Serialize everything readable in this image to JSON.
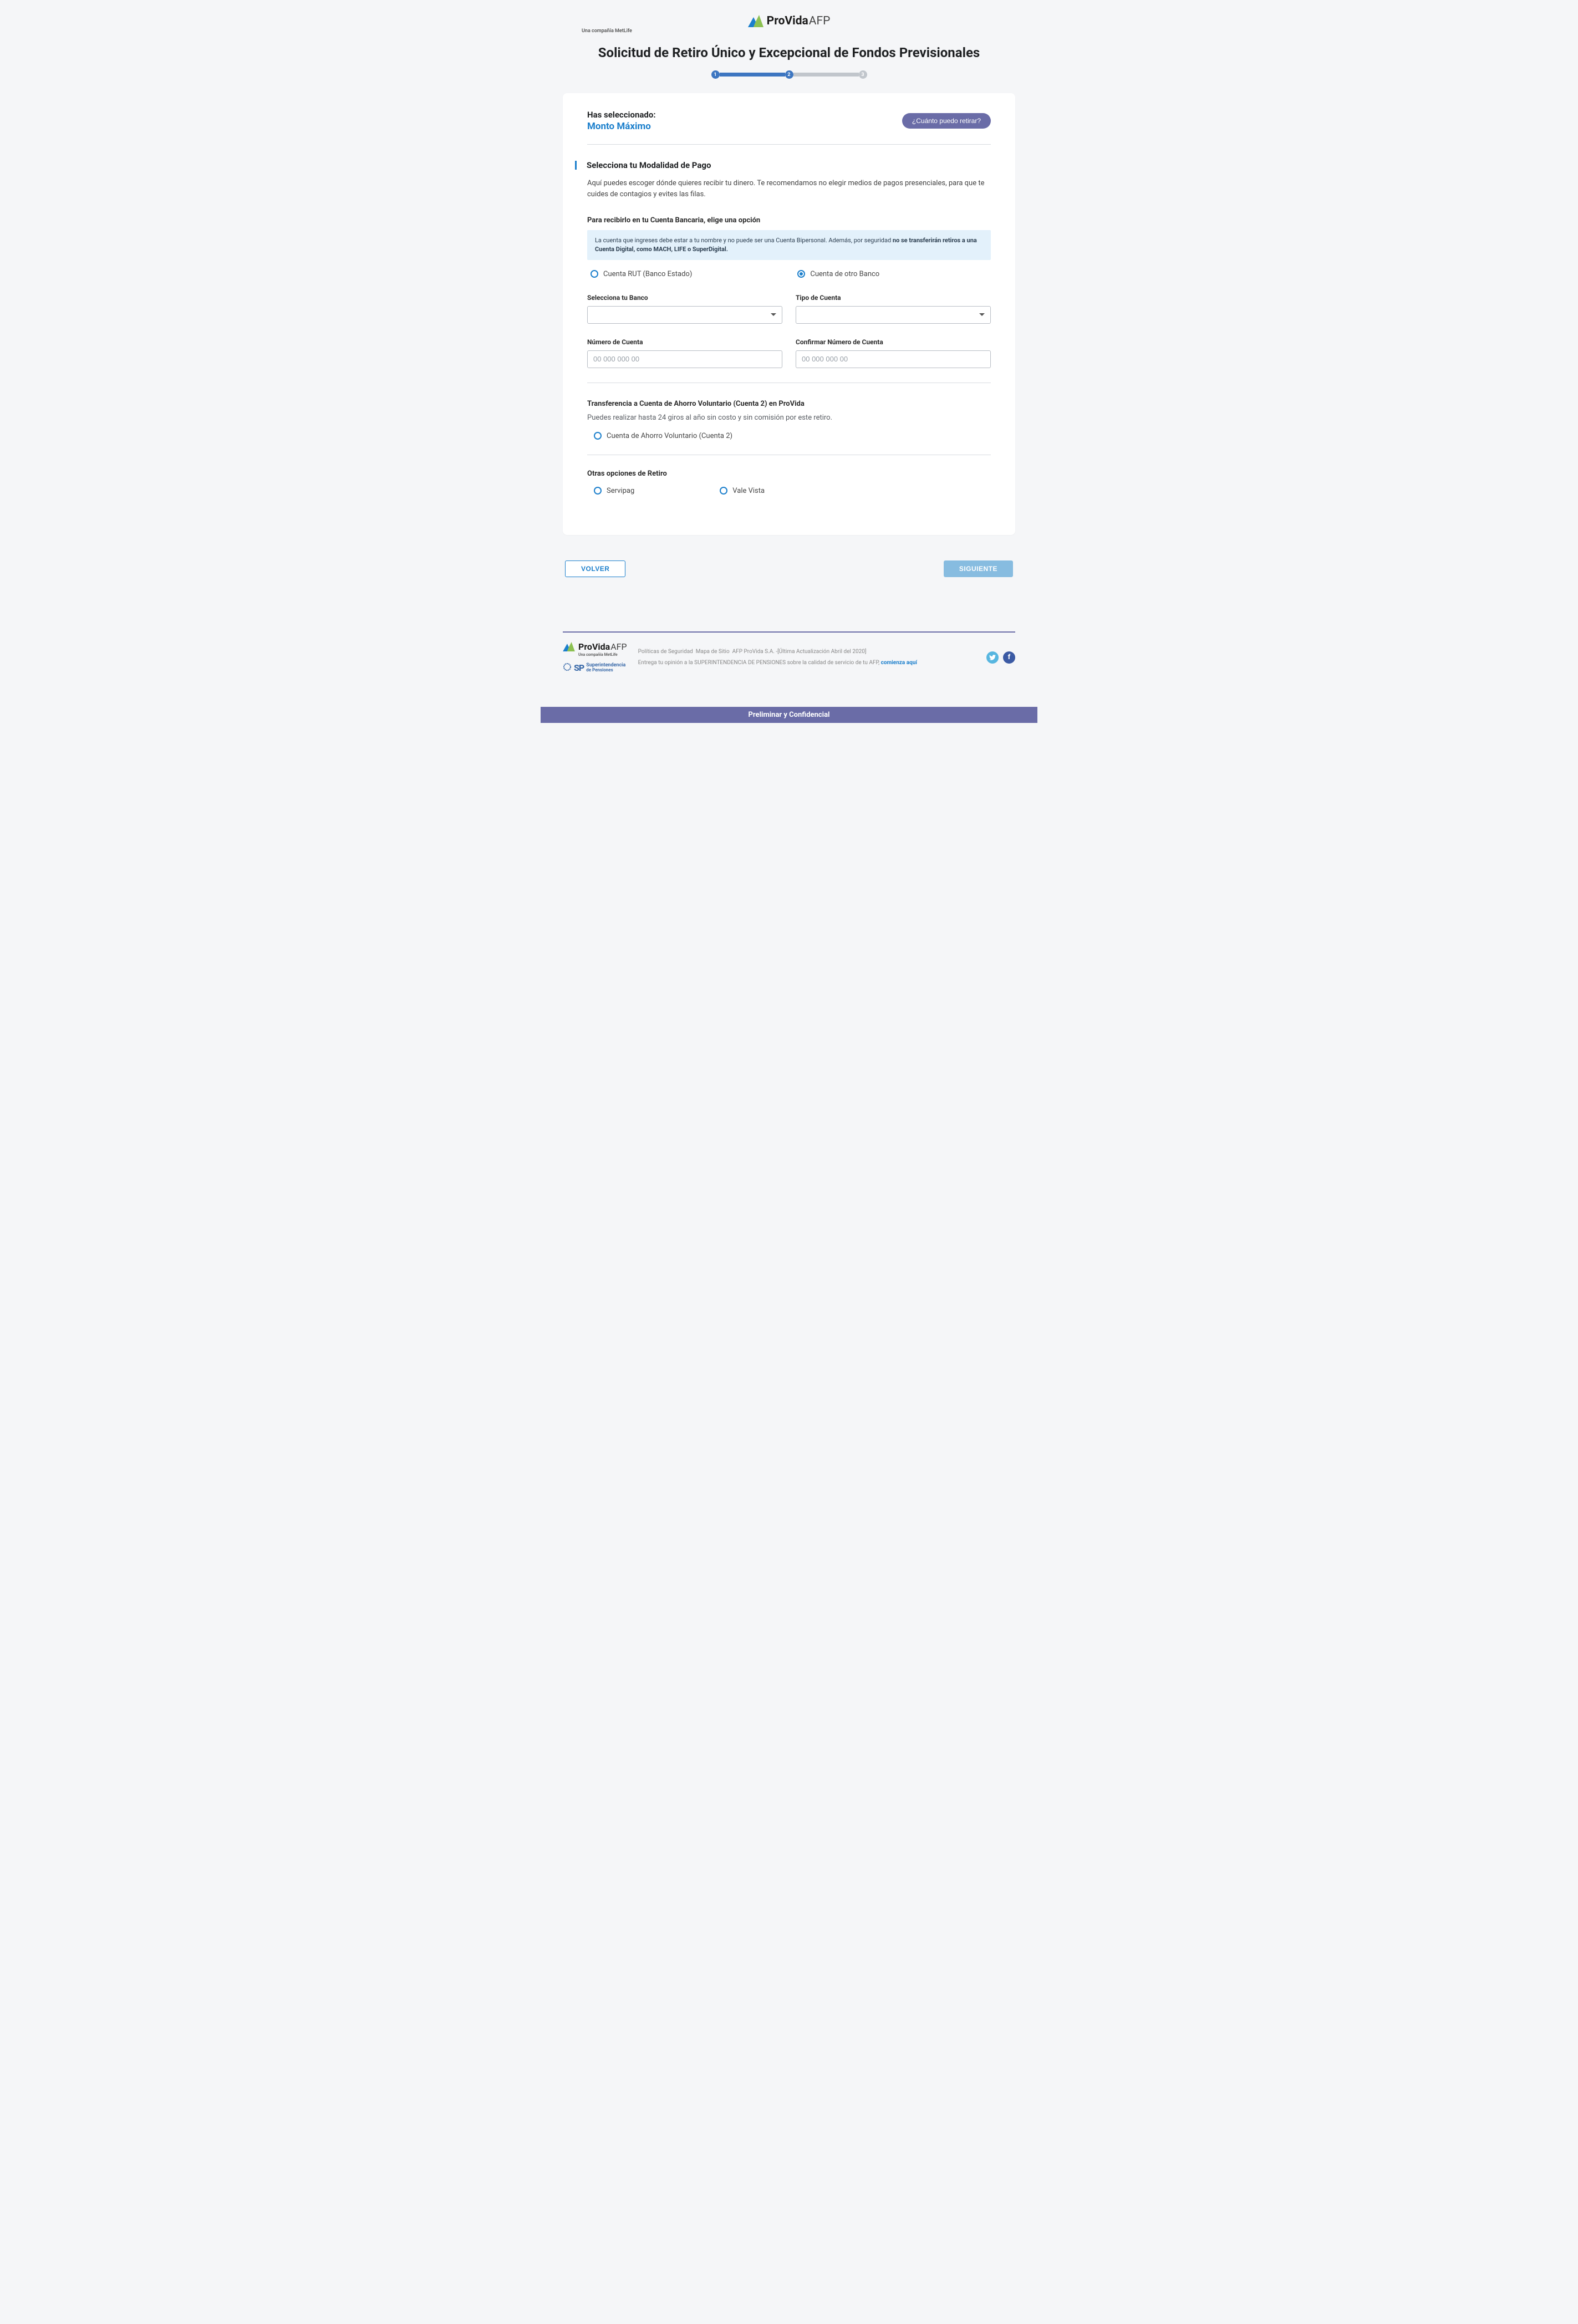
{
  "brand": {
    "name_bold": "ProVida",
    "name_thin": "AFP",
    "tagline": "Una compañía MetLife"
  },
  "page_title": "Solicitud de Retiro Único y Excepcional de Fondos Previsionales",
  "stepper": {
    "step1": "1",
    "step2": "2",
    "step3": "3"
  },
  "selection": {
    "label": "Has seleccionado:",
    "value": "Monto Máximo",
    "help_button": "¿Cuánto puedo retirar?"
  },
  "section_paymode": {
    "title": "Selecciona tu Modalidad de Pago",
    "desc": "Aquí puedes escoger dónde quieres recibir tu dinero. Te recomendamos no elegir medios de pagos presenciales, para que te cuides de contagios y evites las filas."
  },
  "bank_section": {
    "sub_label": "Para recibirlo en tu Cuenta Bancaria, elige una opción",
    "info_part1": "La cuenta que ingreses debe estar a tu nombre y no puede ser una Cuenta Bipersonal. Además, por seguridad ",
    "info_bold": "no se transferirán retiros a una Cuenta Digital, como MACH, LIFE o SuperDigital.",
    "radio_rut": "Cuenta RUT (Banco Estado)",
    "radio_other": "Cuenta de otro Banco"
  },
  "bank_form": {
    "bank_label": "Selecciona tu Banco",
    "type_label": "Tipo de Cuenta",
    "num_label": "Número de Cuenta",
    "num_placeholder": "00 000 000 00",
    "conf_label": "Confirmar Número de Cuenta",
    "conf_placeholder": "00 000 000 00"
  },
  "cuenta2_section": {
    "title": "Transferencia a Cuenta de Ahorro Voluntario (Cuenta 2) en ProVida",
    "note": "Puedes realizar hasta 24 giros al año sin costo y sin comisión por este retiro.",
    "radio": "Cuenta de Ahorro Voluntario (Cuenta 2)"
  },
  "other_section": {
    "title": "Otras opciones de Retiro",
    "radio_servipag": "Servipag",
    "radio_vale": "Vale Vista"
  },
  "actions": {
    "back": "VOLVER",
    "next": "SIGUIENTE"
  },
  "footer": {
    "links_line": "Políticas de Seguridad  Mapa de Sitio  AFP ProVida S.A. -[Última Actualización Abril del 2020]",
    "opinion_prefix": "Entrega tu opinión a la SUPERINTENDENCIA DE PENSIONES sobre la calidad de servicio de tu AFP, ",
    "opinion_link": "comienza aquí",
    "sp_label_line1": "Superintendencia",
    "sp_label_line2": "de Pensiones",
    "sp_mark": "SP"
  },
  "confidential_banner": "Preliminar y Confidencial"
}
